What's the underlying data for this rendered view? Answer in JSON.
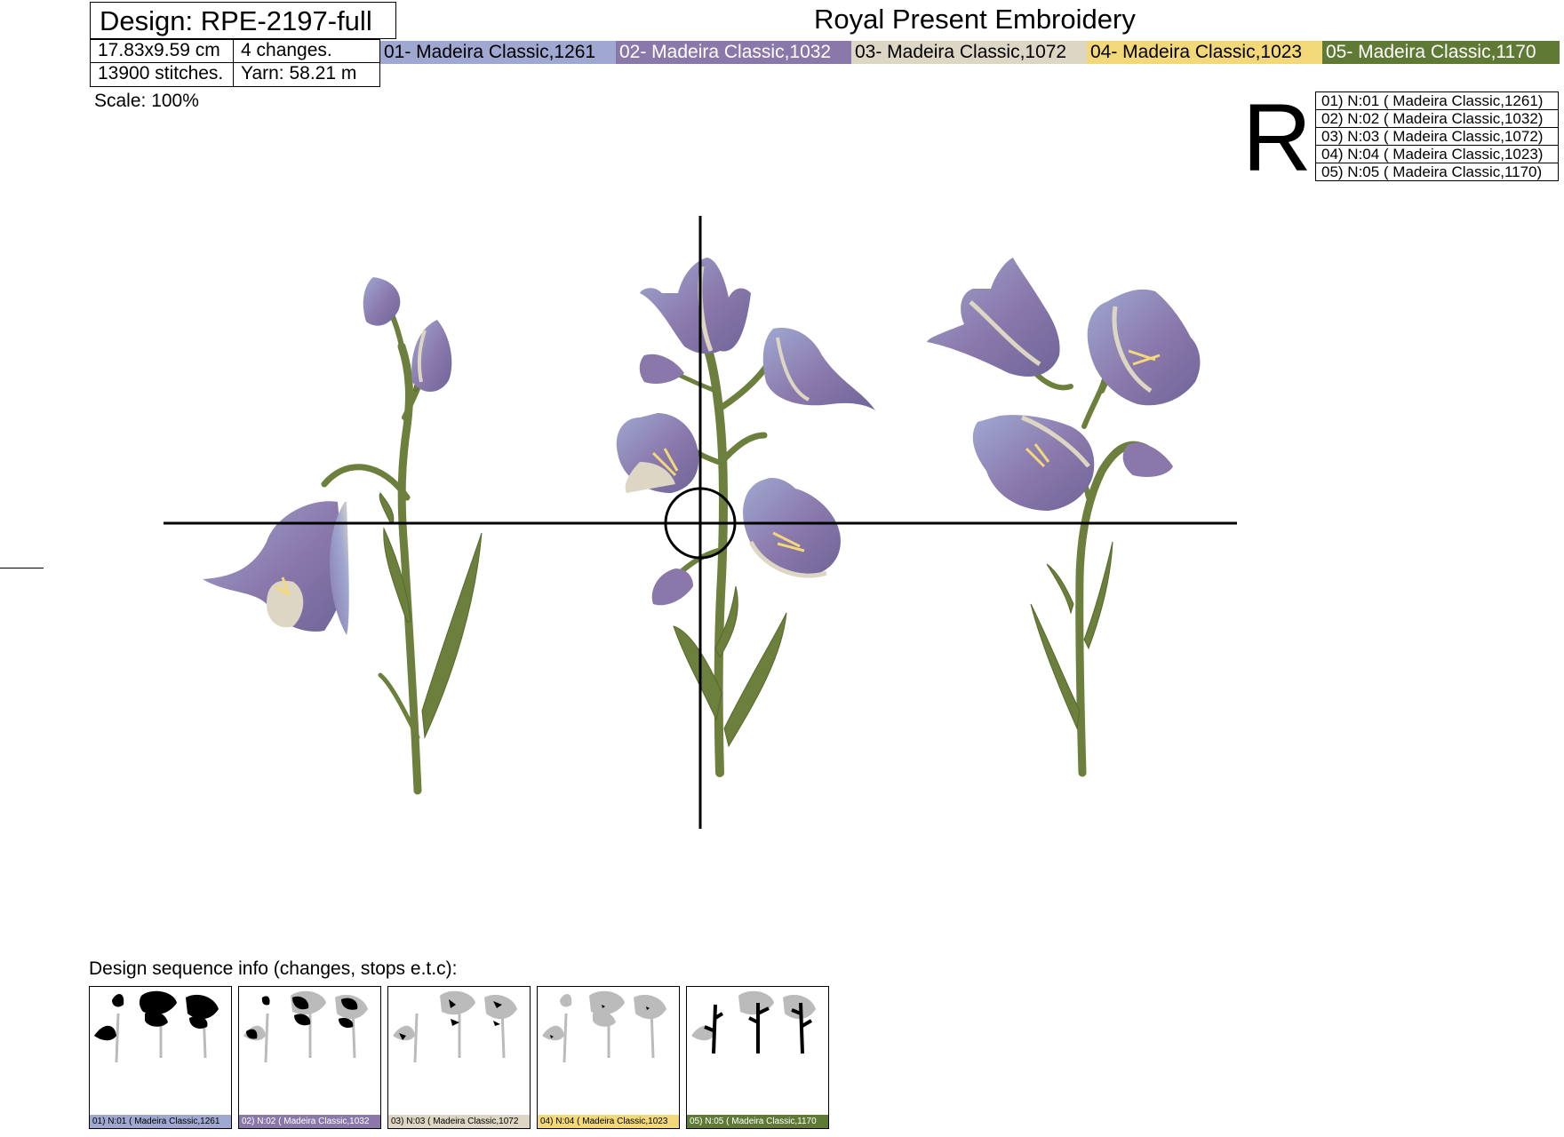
{
  "header": {
    "design_label": "Design: RPE-2197-full",
    "brand": "Royal Present Embroidery",
    "size": "17.83x9.59 cm",
    "changes": "4 changes.",
    "stitches": "13900 stitches.",
    "yarn": "Yarn: 58.21 m",
    "scale": "Scale: 100%"
  },
  "colors": [
    {
      "label": "01- Madeira Classic,1261",
      "hex": "#9fa8d0",
      "text": "#000000"
    },
    {
      "label": "02- Madeira Classic,1032",
      "hex": "#8a78ab",
      "text": "#ffffff"
    },
    {
      "label": "03- Madeira Classic,1072",
      "hex": "#ddd6c4",
      "text": "#000000"
    },
    {
      "label": "04- Madeira Classic,1023",
      "hex": "#f2d878",
      "text": "#000000"
    },
    {
      "label": "05- Madeira Classic,1170",
      "hex": "#5f7a35",
      "text": "#ffffff"
    }
  ],
  "legend": {
    "letter": "R",
    "rows": [
      "01) N:01 ( Madeira Classic,1261)",
      "02) N:02 ( Madeira Classic,1032)",
      "03) N:03 ( Madeira Classic,1072)",
      "04) N:04 ( Madeira Classic,1023)",
      "05) N:05 ( Madeira Classic,1170)"
    ]
  },
  "sequence": {
    "title": "Design sequence info (changes, stops e.t.c):",
    "captions": [
      "01) N:01 ( Madeira Classic,1261",
      "02) N:02 ( Madeira Classic,1032",
      "03) N:03 ( Madeira Classic,1072",
      "04) N:04 ( Madeira Classic,1023",
      "05) N:05 ( Madeira Classic,1170"
    ]
  }
}
